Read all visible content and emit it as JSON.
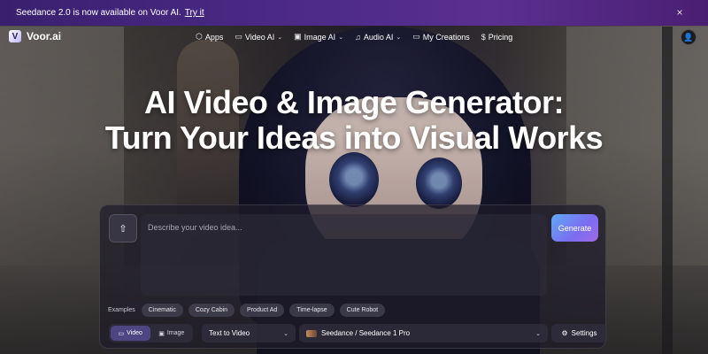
{
  "announcement": {
    "text": "Seedance 2.0 is now available on Voor AI.",
    "link": "Try it",
    "close_glyph": "×"
  },
  "brand": {
    "mark": "V",
    "name": "Voor.ai"
  },
  "nav": {
    "items": [
      {
        "label": "Apps",
        "icon": "cube-icon",
        "glyph": "⬡"
      },
      {
        "label": "Video AI",
        "icon": "video-icon",
        "glyph": "▭",
        "dropdown": true
      },
      {
        "label": "Image AI",
        "icon": "image-icon",
        "glyph": "▣",
        "dropdown": true
      },
      {
        "label": "Audio AI",
        "icon": "music-icon",
        "glyph": "♫",
        "dropdown": true
      },
      {
        "label": "My Creations",
        "icon": "folder-icon",
        "glyph": "▭"
      },
      {
        "label": "Pricing",
        "icon": "dollar-icon",
        "glyph": "$"
      }
    ],
    "chevron": "⌄",
    "avatar_glyph": "👤"
  },
  "hero": {
    "line1": "AI Video & Image Generator:",
    "line2": "Turn Your Ideas into Visual Works"
  },
  "composer": {
    "upload_glyph": "⇧",
    "placeholder": "Describe your video idea...",
    "generate_label": "Generate",
    "examples_label": "Examples",
    "examples": [
      "Cinematic",
      "Cozy Cabin",
      "Product Ad",
      "Time-lapse",
      "Cute Robot"
    ],
    "modes": [
      {
        "label": "Video",
        "active": true,
        "glyph": "▭"
      },
      {
        "label": "Image",
        "active": false,
        "glyph": "▣"
      }
    ],
    "mode_select": "Text to Video",
    "model_select": "Seedance / Seedance 1 Pro",
    "settings_label": "Settings",
    "settings_glyph": "⚙",
    "chevron": "⌄"
  },
  "colors": {
    "announce_bg": "#4b2a86",
    "generate_gradient_start": "#5fa8f5",
    "generate_gradient_end": "#9f6be8",
    "active_mode": "#5f55aa"
  }
}
